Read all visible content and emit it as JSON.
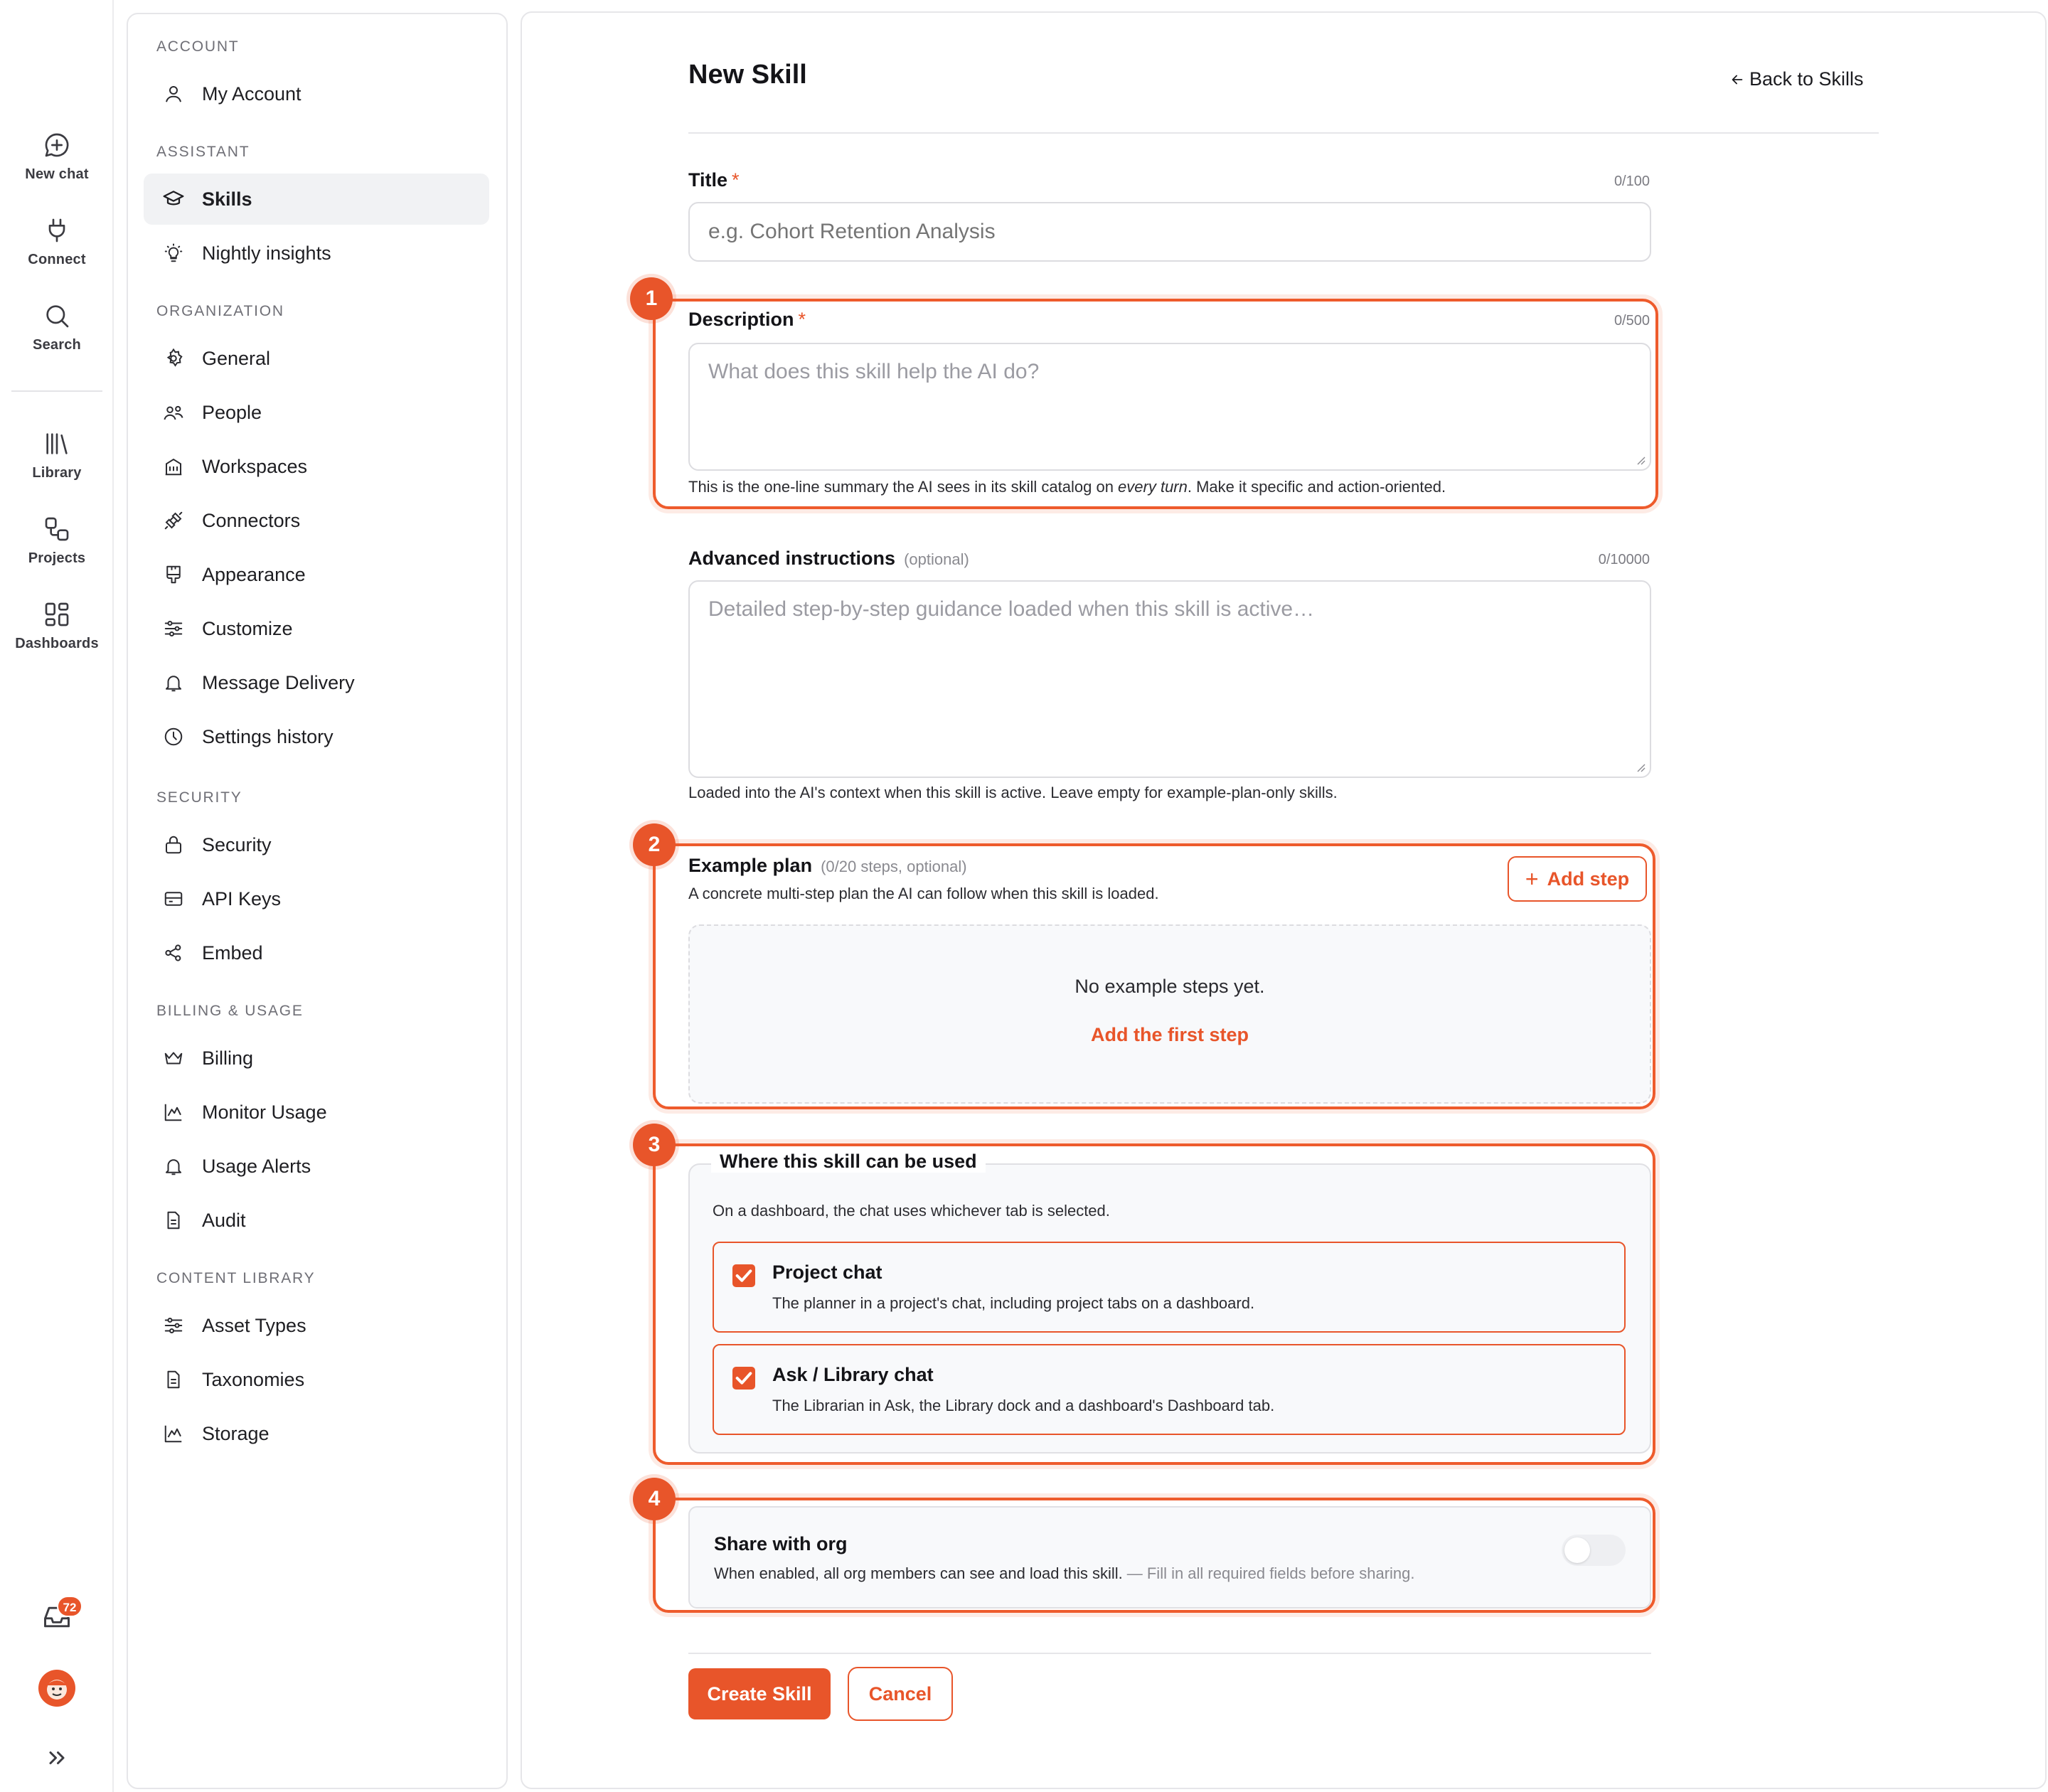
{
  "rail": {
    "new_chat": "New chat",
    "connect": "Connect",
    "search": "Search",
    "library": "Library",
    "projects": "Projects",
    "dashboards": "Dashboards",
    "inbox_count": "72"
  },
  "sidebar": {
    "account_heading": "ACCOUNT",
    "my_account": "My Account",
    "assistant_heading": "ASSISTANT",
    "skills": "Skills",
    "nightly_insights": "Nightly insights",
    "organization_heading": "ORGANIZATION",
    "general": "General",
    "people": "People",
    "workspaces": "Workspaces",
    "connectors": "Connectors",
    "appearance": "Appearance",
    "customize": "Customize",
    "message_delivery": "Message Delivery",
    "settings_history": "Settings history",
    "security_heading": "SECURITY",
    "security": "Security",
    "api_keys": "API Keys",
    "embed": "Embed",
    "billing_heading": "BILLING & USAGE",
    "billing": "Billing",
    "monitor_usage": "Monitor Usage",
    "usage_alerts": "Usage Alerts",
    "audit": "Audit",
    "content_heading": "CONTENT LIBRARY",
    "asset_types": "Asset Types",
    "taxonomies": "Taxonomies",
    "storage": "Storage"
  },
  "page": {
    "title": "New Skill",
    "back_link": "Back to Skills"
  },
  "form": {
    "title_label": "Title",
    "required_mark": "*",
    "title_count": "0/100",
    "title_placeholder": "e.g. Cohort Retention Analysis",
    "description_label": "Description",
    "description_count": "0/500",
    "description_placeholder": "What does this skill help the AI do?",
    "description_hint_before": "This is the one-line summary the AI sees in its skill catalog on ",
    "description_hint_em": "every turn",
    "description_hint_after": ". Make it specific and action-oriented.",
    "advanced_label": "Advanced instructions",
    "advanced_optional": "(optional)",
    "advanced_count": "0/10000",
    "advanced_placeholder": "Detailed step-by-step guidance loaded when this skill is active…",
    "advanced_hint": "Loaded into the AI's context when this skill is active. Leave empty for example-plan-only skills.",
    "plan_label": "Example plan",
    "plan_meta": "(0/20 steps, optional)",
    "plan_hint": "A concrete multi-step plan the AI can follow when this skill is loaded.",
    "add_step": "Add step",
    "plan_empty": "No example steps yet.",
    "plan_first": "Add the first step",
    "where_legend": "Where this skill can be used",
    "where_note": "On a dashboard, the chat uses whichever tab is selected.",
    "project_chat_title": "Project chat",
    "project_chat_desc": "The planner in a project's chat, including project tabs on a dashboard.",
    "project_chat_checked": true,
    "ask_chat_title": "Ask / Library chat",
    "ask_chat_desc": "The Librarian in Ask, the Library dock and a dashboard's Dashboard tab.",
    "ask_chat_checked": true,
    "share_title": "Share with org",
    "share_desc": "When enabled, all org members can see and load this skill.",
    "share_warn": "— Fill in all required fields before sharing.",
    "share_enabled": false,
    "create_button": "Create Skill",
    "cancel_button": "Cancel"
  },
  "annotations": [
    "1",
    "2",
    "3",
    "4"
  ],
  "colors": {
    "accent": "#e8552a",
    "highlight": "#ee5b2c",
    "active_nav_bg": "#f1f2f4"
  }
}
